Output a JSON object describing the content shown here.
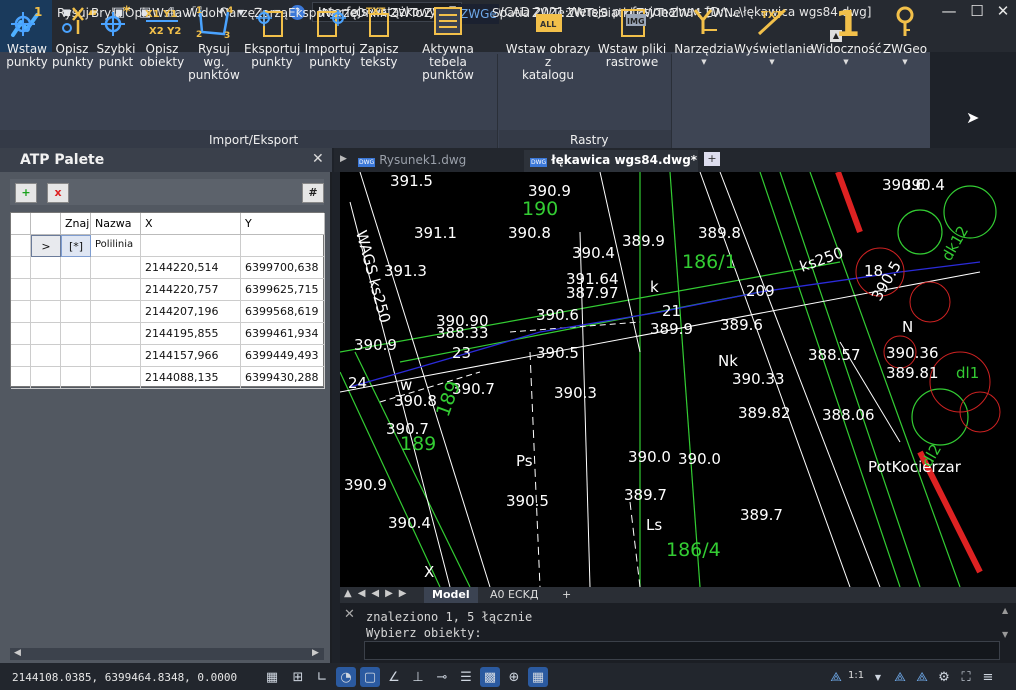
{
  "quick_access": {
    "workspace": "Interfejs wstążkowy",
    "window_title": "ZWCAD 2021 Wersja profesjonalna - [D:\\...\\łękawica wgs84.dwg]"
  },
  "menu": {
    "items": [
      "Rysuj",
      "Bryła",
      "Opis",
      "Wstav",
      "Widol",
      "Narzę",
      "Zarzą",
      "Ekspo",
      "Narzę",
      "Onlin",
      "ZWTo",
      "ZWBl",
      "ZWGe",
      "Spatia",
      "ZWTe:",
      "ZWTe:",
      "Siatki",
      "ZWTe:",
      "ZWM",
      "ZWNe"
    ],
    "active_index": 12
  },
  "ribbon": {
    "import_export": {
      "title": "Import/Eksport",
      "buttons": [
        {
          "line1": "Wstaw",
          "line2": "punkty",
          "icon": "insert-points-icon"
        },
        {
          "line1": "Opisz",
          "line2": "punkty",
          "icon": "describe-points-icon"
        },
        {
          "line1": "Szybki",
          "line2": "punkt",
          "icon": "quick-point-icon"
        },
        {
          "line1": "Opisz",
          "line2": "obiekty",
          "icon": "describe-objects-icon"
        },
        {
          "line1": "Rysuj wg.",
          "line2": "punktów",
          "icon": "draw-by-points-icon"
        },
        {
          "line1": "Eksportuj",
          "line2": "punkty",
          "icon": "export-points-icon"
        },
        {
          "line1": "Importuj",
          "line2": "punkty",
          "icon": "import-points-icon"
        },
        {
          "line1": "Zapisz",
          "line2": "teksty",
          "icon": "save-texts-icon"
        },
        {
          "line1": "Aktywna tebela",
          "line2": "punktów",
          "icon": "active-table-icon"
        }
      ],
      "icon_labels": {
        "describe_objects": "X1 Y1 X2 Y2",
        "draw_numbers": "1 2 3 4",
        "save_texts": "TXT"
      }
    },
    "rastry": {
      "title": "Rastry",
      "buttons": [
        {
          "line1": "Wstaw obrazy z",
          "line2": "katalogu",
          "icon": "insert-images-icon",
          "badge": "ALL"
        },
        {
          "line1": "Wstaw pliki",
          "line2": "rastrowe",
          "icon": "insert-raster-icon",
          "badge": "IMG"
        }
      ]
    },
    "dropdowns": [
      {
        "label": "Narzędzia",
        "icon": "tools-icon",
        "glyph": "Y"
      },
      {
        "label": "Wyświetlanie",
        "icon": "display-icon",
        "glyph": "TXT"
      },
      {
        "label": "Widoczność",
        "icon": "visibility-icon",
        "glyph": "1"
      },
      {
        "label": "ZWGeo",
        "icon": "zwgeo-icon"
      }
    ]
  },
  "palette": {
    "title": "ATP Palete",
    "add": "+",
    "remove": "x",
    "hash": "#",
    "columns": [
      "Znaj",
      "Nazwa",
      "X",
      "Y"
    ],
    "first_row": {
      "marker": ">",
      "znaj": "[*]",
      "nazwa": "Polilinia"
    },
    "rows": [
      {
        "x": "2144220,514",
        "y": "6399700,638"
      },
      {
        "x": "2144220,757",
        "y": "6399625,715"
      },
      {
        "x": "2144207,196",
        "y": "6399568,619"
      },
      {
        "x": "2144195,855",
        "y": "6399461,934"
      },
      {
        "x": "2144157,966",
        "y": "6399449,493"
      },
      {
        "x": "2144088,135",
        "y": "6399430,288"
      }
    ]
  },
  "doc_tabs": [
    {
      "label": "Rysunek1.dwg",
      "active": false,
      "badge": "DWG"
    },
    {
      "label": "łękawica wgs84.dwg*",
      "active": true,
      "badge": "DWG"
    }
  ],
  "layout_tabs": [
    "Model",
    "A0 ECKД",
    "+"
  ],
  "drawing": {
    "labels": [
      {
        "t": "391.5",
        "c": "#ffffff"
      },
      {
        "t": "390.9",
        "c": "#ffffff"
      },
      {
        "t": "190",
        "c": "#33cc33"
      },
      {
        "t": "391.1",
        "c": "#ffffff"
      },
      {
        "t": "390.8",
        "c": "#ffffff"
      },
      {
        "t": "389.9",
        "c": "#ffffff"
      },
      {
        "t": "389.8",
        "c": "#ffffff"
      },
      {
        "t": "390.4",
        "c": "#ffffff"
      },
      {
        "t": "186/1",
        "c": "#33cc33"
      },
      {
        "t": "391.3",
        "c": "#ffffff"
      },
      {
        "t": "391.64",
        "c": "#ffffff"
      },
      {
        "t": "387.97",
        "c": "#ffffff"
      },
      {
        "t": "k",
        "c": "#ffffff"
      },
      {
        "t": "21",
        "c": "#ffffff"
      },
      {
        "t": "209",
        "c": "#ffffff"
      },
      {
        "t": "390.90",
        "c": "#ffffff"
      },
      {
        "t": "388.33",
        "c": "#ffffff"
      },
      {
        "t": "390.6",
        "c": "#ffffff"
      },
      {
        "t": "389.9",
        "c": "#ffffff"
      },
      {
        "t": "389.6",
        "c": "#ffffff"
      },
      {
        "t": "390.9",
        "c": "#ffffff"
      },
      {
        "t": "23",
        "c": "#ffffff"
      },
      {
        "t": "390.5",
        "c": "#ffffff"
      },
      {
        "t": "Nk",
        "c": "#ffffff"
      },
      {
        "t": "388.57",
        "c": "#ffffff"
      },
      {
        "t": "390.36",
        "c": "#ffffff"
      },
      {
        "t": "24",
        "c": "#ffffff"
      },
      {
        "t": "390.7",
        "c": "#ffffff"
      },
      {
        "t": "390.33",
        "c": "#ffffff"
      },
      {
        "t": "389.81",
        "c": "#ffffff"
      },
      {
        "t": "390.8",
        "c": "#ffffff"
      },
      {
        "t": "390.3",
        "c": "#ffffff"
      },
      {
        "t": "389.82",
        "c": "#ffffff"
      },
      {
        "t": "388.06",
        "c": "#ffffff"
      },
      {
        "t": "390.7",
        "c": "#ffffff"
      },
      {
        "t": "189",
        "c": "#33cc33"
      },
      {
        "t": "390.0",
        "c": "#ffffff"
      },
      {
        "t": "390.0",
        "c": "#ffffff"
      },
      {
        "t": "Ps",
        "c": "#ffffff"
      },
      {
        "t": "390.9",
        "c": "#ffffff"
      },
      {
        "t": "389.7",
        "c": "#ffffff"
      },
      {
        "t": "390.5",
        "c": "#ffffff"
      },
      {
        "t": "389.7",
        "c": "#ffffff"
      },
      {
        "t": "390.4",
        "c": "#ffffff"
      },
      {
        "t": "Ls",
        "c": "#ffffff"
      },
      {
        "t": "186/4",
        "c": "#33cc33"
      },
      {
        "t": "390.6",
        "c": "#ffffff"
      },
      {
        "t": "18",
        "c": "#ffffff"
      },
      {
        "t": "390.5",
        "c": "#ffffff"
      },
      {
        "t": "N",
        "c": "#ffffff"
      },
      {
        "t": "PotKocierzar",
        "c": "#ffffff"
      },
      {
        "t": "390.4",
        "c": "#ffffff"
      },
      {
        "t": "X",
        "c": "#ffffff"
      },
      {
        "t": "w",
        "c": "#ffffff"
      },
      {
        "t": "ks250",
        "c": "#ffffff"
      },
      {
        "t": "dl1",
        "c": "#33cc33"
      },
      {
        "t": "dl2",
        "c": "#33cc33"
      },
      {
        "t": "WAGS ks250",
        "c": "#ffffff"
      },
      {
        "t": "dk12",
        "c": "#33cc33"
      },
      {
        "t": "189",
        "c": "#33cc33"
      }
    ]
  },
  "command": {
    "lines": [
      "znaleziono 1, 5 łącznie",
      "Wybierz obiekty:"
    ]
  },
  "status": {
    "coords": "2144108.0385, 6399464.8348, 0.0000",
    "scale": "1:1"
  }
}
